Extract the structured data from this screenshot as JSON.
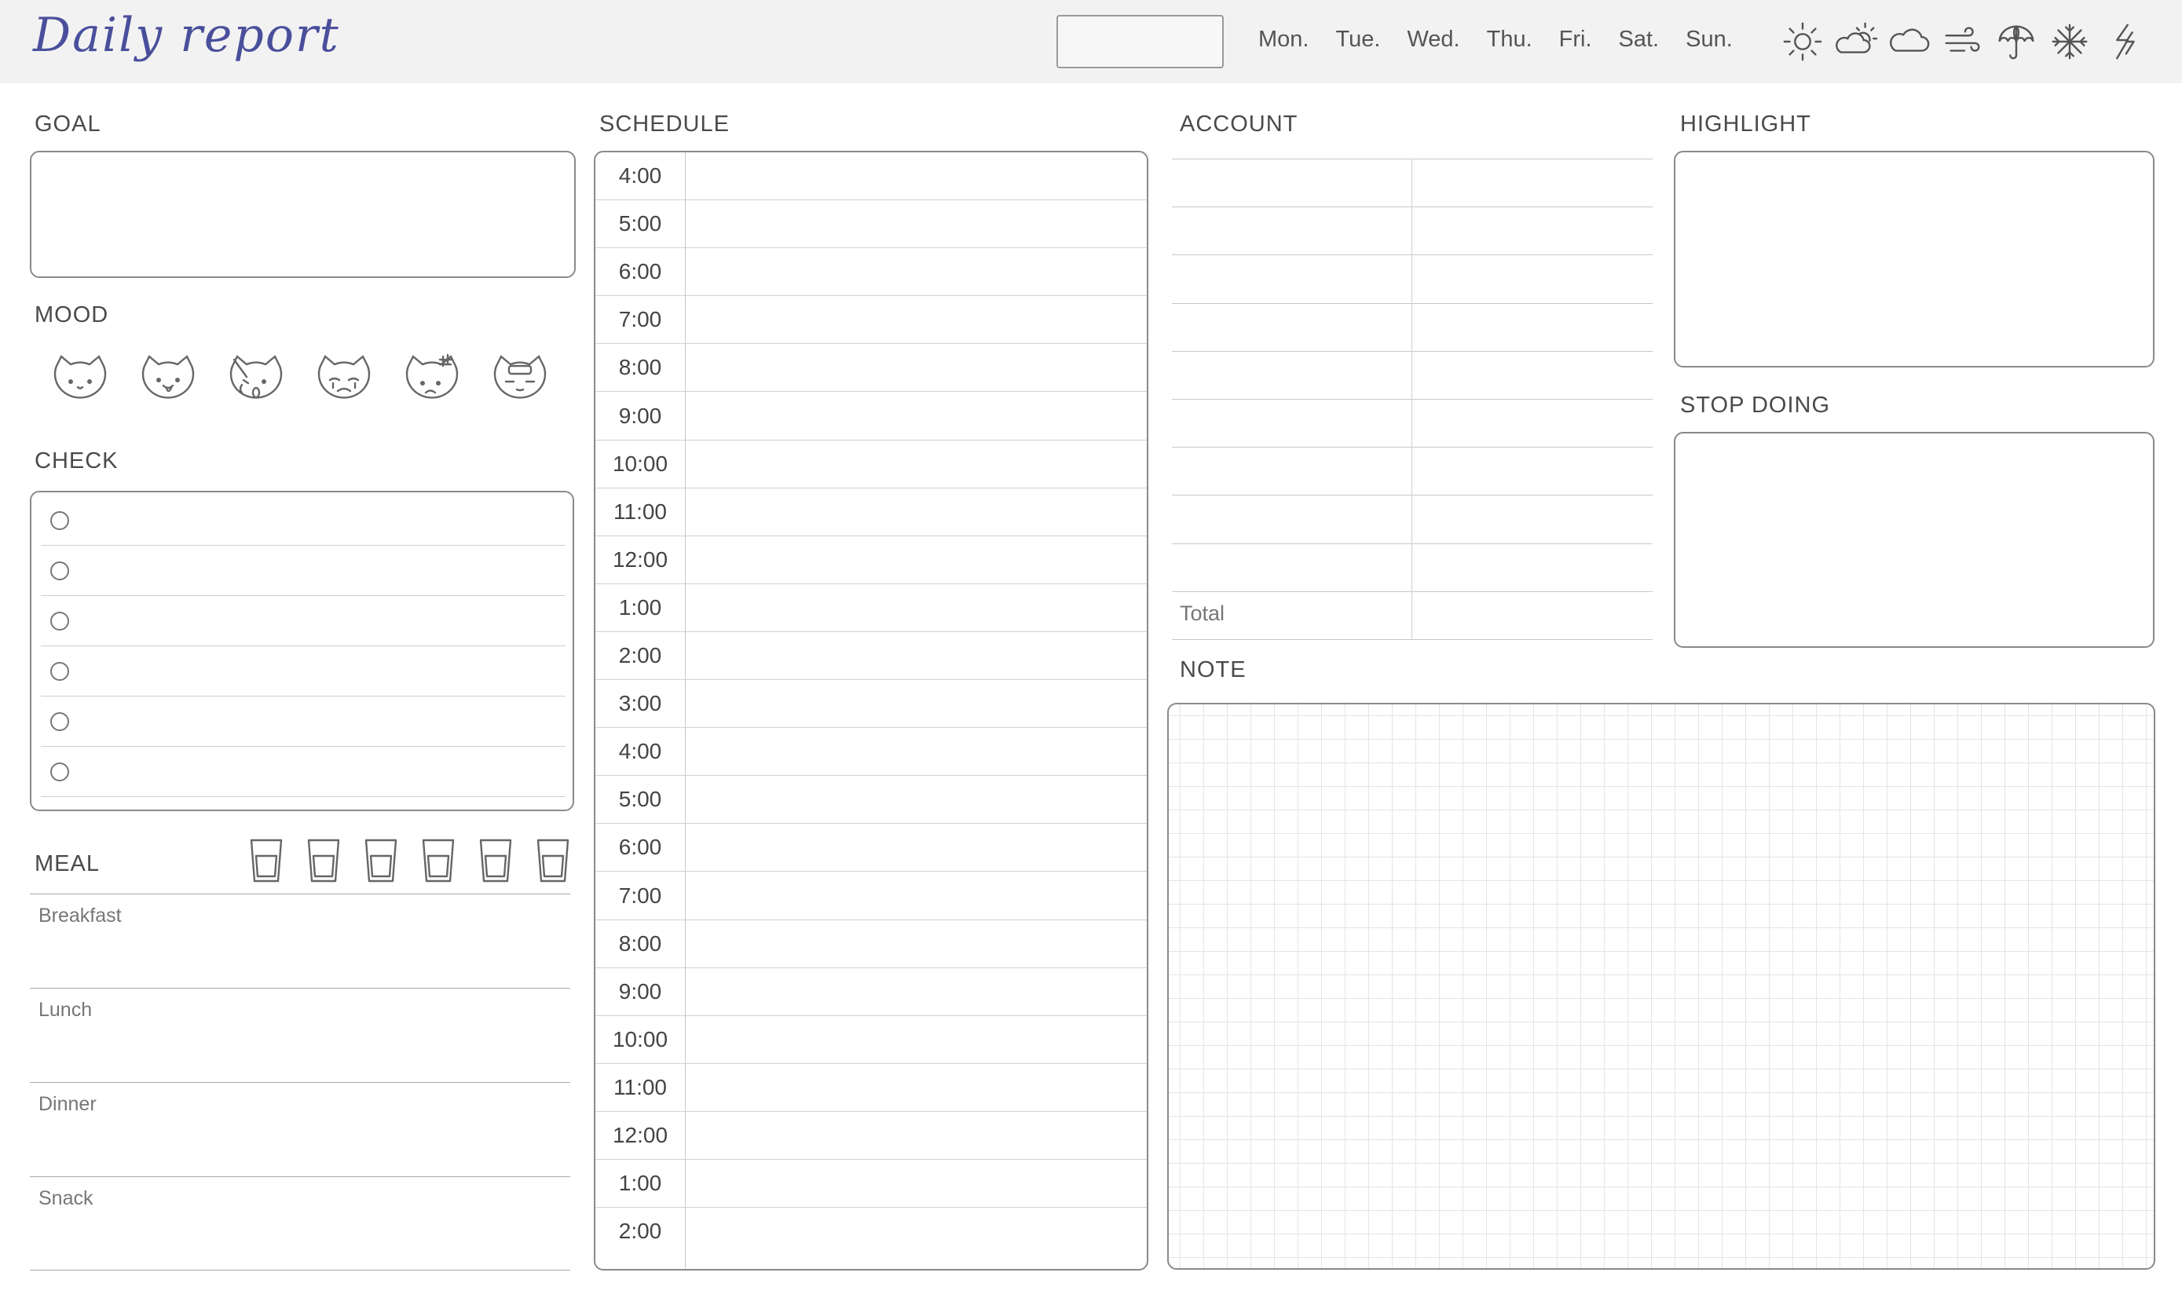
{
  "header": {
    "title": "Daily report",
    "days": [
      "Mon.",
      "Tue.",
      "Wed.",
      "Thu.",
      "Fri.",
      "Sat.",
      "Sun."
    ],
    "weather_icons": [
      "sun-icon",
      "partly-cloudy-icon",
      "cloud-icon",
      "wind-icon",
      "umbrella-icon",
      "snowflake-icon",
      "lightning-icon"
    ]
  },
  "sections": {
    "goal": "GOAL",
    "mood": "MOOD",
    "check": "CHECK",
    "meal": "MEAL",
    "schedule": "SCHEDULE",
    "account": "ACCOUNT",
    "highlight": "HIGHLIGHT",
    "stop_doing": "STOP DOING",
    "note": "NOTE"
  },
  "mood_icons": [
    "cat-calm-icon",
    "cat-happy-icon",
    "cat-surprised-icon",
    "cat-crying-icon",
    "cat-angry-icon",
    "cat-tired-icon"
  ],
  "check_count": 6,
  "water_cups": 6,
  "meals": [
    "Breakfast",
    "Lunch",
    "Dinner",
    "Snack"
  ],
  "schedule_times": [
    "4:00",
    "5:00",
    "6:00",
    "7:00",
    "8:00",
    "9:00",
    "10:00",
    "11:00",
    "12:00",
    "1:00",
    "2:00",
    "3:00",
    "4:00",
    "5:00",
    "6:00",
    "7:00",
    "8:00",
    "9:00",
    "10:00",
    "11:00",
    "12:00",
    "1:00",
    "2:00"
  ],
  "account": {
    "total_label": "Total"
  },
  "colors": {
    "title": "#4a4f9c",
    "border": "#8a8a8a",
    "topbar": "#f2f2f2"
  }
}
